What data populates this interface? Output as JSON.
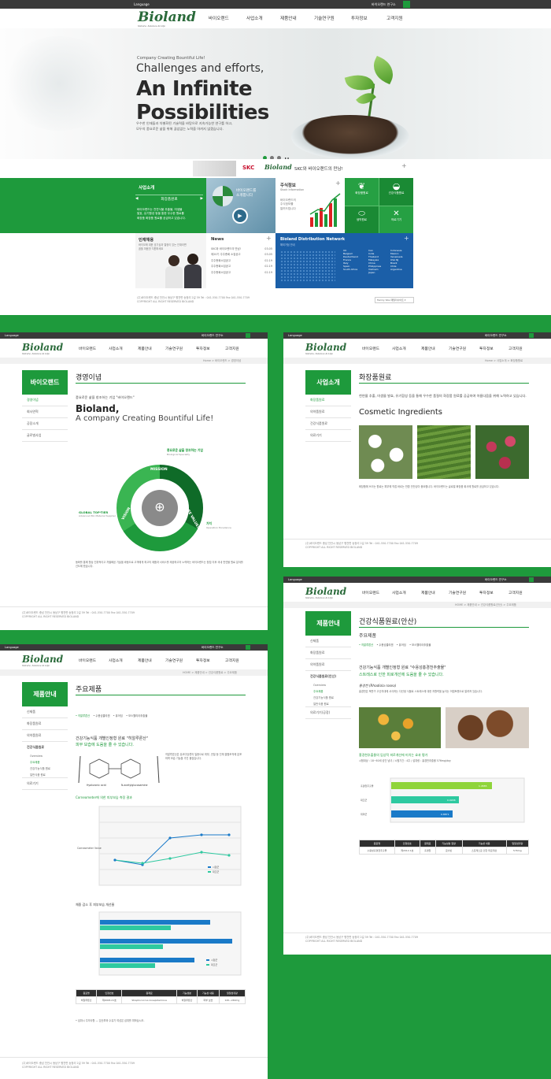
{
  "main": {
    "topbar": {
      "language": "Language",
      "right_label": "바이오랜드 연구소"
    },
    "logo": {
      "name": "Bioland",
      "tagline": "Nature, Science & Life"
    },
    "nav": [
      "바이오랜드",
      "사업소개",
      "제품안내",
      "기술연구원",
      "투자정보",
      "고객지원"
    ],
    "hero": {
      "small": "Company Creating Bountiful Life!",
      "line1": "Challenges and efforts,",
      "line2": "An Infinite",
      "line3": "Possibilities",
      "desc1": "우수한 인재들과 차별화된 기술력을 바탕으로 지속가능한 연구를 하고,",
      "desc2": "모두의 풍요로운 삶을 위해 끊임없는 노력을 아끼지 않겠습니다."
    },
    "banner": {
      "skc": "SKC",
      "bioland": "Bioland",
      "text": "SKC와 바이오랜드의 만남!",
      "plus": "+"
    },
    "about": {
      "title": "사업소개",
      "sub": "화장품원료",
      "text1": "바이오랜드는 천연식물 추출물, 미생물",
      "text2": "발효, 유기합성 등을 통한 우수한 원료를",
      "text3": "화장품 화장품 원료를 공급하고 있습니다."
    },
    "video": {
      "caption1": "바이오랜드를",
      "caption2": "소개합니다"
    },
    "stock": {
      "title": "주식정보",
      "sub": "Stock Information",
      "text1": "바이오랜드의",
      "text2": "주식정보를",
      "text3": "알려드립니다"
    },
    "quick": [
      "화장품원료",
      "건강식품원료",
      "생약원료",
      "의료기기"
    ],
    "recruit": {
      "title": "인재채용",
      "text1": "바이오에 대한 호기심과 열정이 있는 인재라면",
      "text2": "꿈을 마음껏 지원하세요"
    },
    "news": {
      "title": "News",
      "items": [
        {
          "t": "SKC와 바이오랜드의 만남!",
          "d": "03.05"
        },
        {
          "t": "제20기 주주총회 소집공고",
          "d": "03.05"
        },
        {
          "t": "주주총회소집공고",
          "d": "02.19"
        },
        {
          "t": "주주총회소집공고",
          "d": "02.19"
        },
        {
          "t": "주주총회소집공고",
          "d": "02.19"
        }
      ]
    },
    "distribution": {
      "title": "Bioland Distribution Network",
      "sub": "해외거점 안내",
      "col1": [
        "UK",
        "Belgium",
        "Deutschland",
        "France",
        "Italy",
        "Spain",
        "South Africa"
      ],
      "col2": [
        "Iran",
        "India",
        "Thailand",
        "Malaysia",
        "China",
        "Philippines",
        "Vietnam",
        "Japan"
      ],
      "col3": [
        "Indonesia",
        "Mexico",
        "Venezuela",
        "USA NJ",
        "Brazil",
        "Chile",
        "Argentina"
      ]
    },
    "footer": {
      "l1": "(주)바이오랜드     충남 천안시 동남구 병천면 송정리 2길 59     Tel : 041-550-7700    Fax 041-550-7709",
      "l2": "COPYRIGHT ALL RIGHT RESERVED BIOLAND",
      "family": "Family Site 패밀리사이트"
    }
  },
  "p1": {
    "side_title": "바이오랜드",
    "side": [
      "경영이념",
      "회사연혁",
      "공장소개",
      "글로벌사업"
    ],
    "crumb": "Home > 바이오랜드 > 경영이념",
    "title": "경영이념",
    "intro": "풍요로운 삶을 창조하는 기업 \"바이오랜드\"",
    "h1": "Bioland,",
    "h2": "A company Creating Bountiful Life!",
    "ring": {
      "top": "MISSION",
      "left": "VISION",
      "right": "CORE VALUES"
    },
    "callouts": [
      {
        "t": "풍요로운 삶을 창조하는 기업",
        "s": "Biological Specialty"
      },
      {
        "t": "GLOBAL TOP-TIER",
        "s": "Advanced Bio Material Supplier"
      },
      {
        "t": "가치",
        "s": "Operation Excellence"
      }
    ],
    "para": "동화를 통해 항상 진취적이고 차별화된 기술을 바탕으로 고객에게 최고의 제품과 서비스를 제공하고자 노력하는 바이오랜드는 창립 이후 국내 천연물 원료 분야를 선도해 왔습니다."
  },
  "p2": {
    "side_title": "사업소개",
    "side": [
      "화장품원료",
      "의약품원료",
      "건강식품원료",
      "의료기기"
    ],
    "crumb": "Home > 사업소개 > 화장품원료",
    "title": "화장품원료",
    "intro": "천연물 추출, 미생물 발효, 유기합성 등을 통해 우수한 품질의 화장품 원료를 공급하여 아름다움을 위해 노력하고 있습니다.",
    "h": "Cosmetic Ingredients",
    "para": "화장품에 쓰이는 원료는 피부에 직접 바르는 만큼 안전성이 중요합니다. 바이오랜드는 글로벌 화장품 회사에 원료를 공급하고 있습니다."
  },
  "p3": {
    "side_title": "제품안내",
    "side": [
      "신제품",
      "화장품원료",
      "의약품원료",
      "건강식품원료"
    ],
    "subs": [
      "Overview",
      "주요제품",
      "건강기능식품 원료",
      "일반식품 원료"
    ],
    "side_more": "의료기기",
    "crumb": "HOME > 제품안내 > 건강식품원료 > 주요제품",
    "title": "주요제품",
    "products": [
      "히알루론산",
      "수용성콜라겐",
      "퓨어딩",
      "보스웰리아추출물"
    ],
    "q1": "건강기능식품 개별인정형 원료 \"히알루론산\"",
    "q2": "피부 보습에 도움을 줄 수 있습니다.",
    "mol1": "Hyaluronic acid",
    "mol2": "N-acetylglucosamine",
    "chart_title": "Corneometer에 의한 피부보습 측정 결과",
    "axis": "Corneometer Value",
    "legend": [
      "시험군",
      "대조군"
    ],
    "bar_title": "체중 감소 후 피부보습 개선율",
    "table_head": [
      "원료명",
      "인정번호",
      "원재료",
      "기능성분",
      "기능성 내용",
      "일일섭취량"
    ],
    "table_row": [
      "히알루론산",
      "제2008-21호",
      "Streptococcus zooepidemicus",
      "히알루론산",
      "피부 보습",
      "120~240mg"
    ]
  },
  "p4": {
    "side_title": "제품안내",
    "side": [
      "신제품",
      "화장품원료",
      "의약품원료",
      "건강식품원료(안산)"
    ],
    "subs": [
      "Overview",
      "주요제품",
      "건강기능식품 원료",
      "일반식품 원료"
    ],
    "side_more": "의료기기(공장)",
    "crumb": "HOME > 제품안내 > 건강식품원료(안산) > 주요제품",
    "title": "건강식품원료(안산)",
    "sub": "주요제품",
    "q1": "건강기능식품 개별인정형 원료 \"수용성홍경천추출물\"",
    "q2": "스트레스로 인한 피로개선에 도움을 줄 수 있습니다.",
    "species": "홍경천 (Rhodiola rosea)",
    "bar_title": "홍경천추출물의 임상적 피로개선에 미치는 효과 평가",
    "bars": [
      {
        "label": "홍경천추출물",
        "v": "1.4585"
      },
      {
        "label": "대조군",
        "v": "0.9938"
      },
      {
        "label": "위약군",
        "v": "0.8871"
      }
    ],
    "table_head": [
      "원료명",
      "인정번호",
      "원재료",
      "기능성분 함량",
      "기능성 내용",
      "일일섭취량"
    ]
  }
}
